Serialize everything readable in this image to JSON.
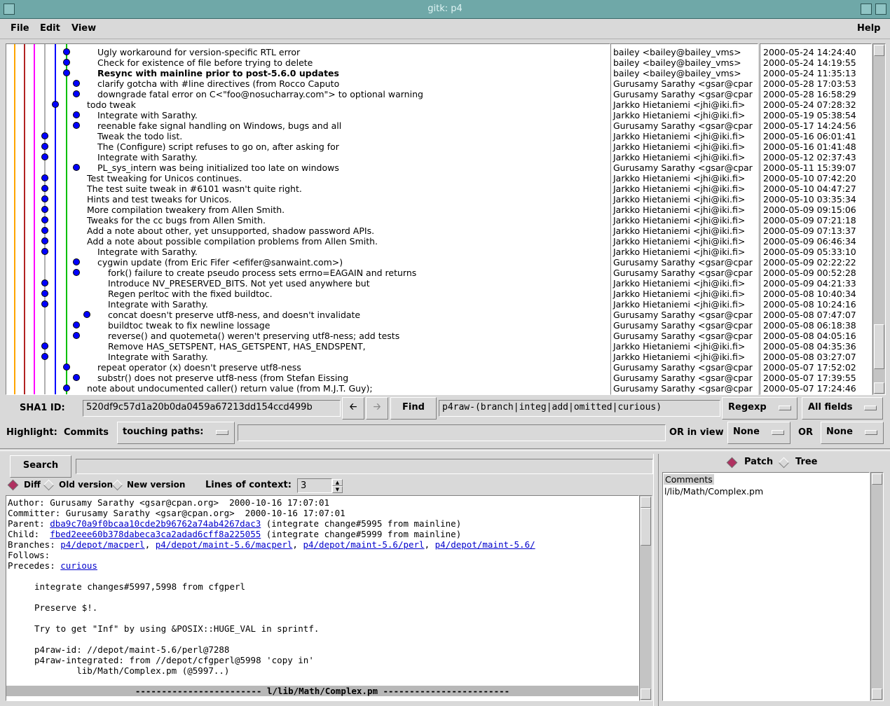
{
  "window": {
    "title": "gitk: p4"
  },
  "menu": {
    "file": "File",
    "edit": "Edit",
    "view": "View",
    "help": "Help"
  },
  "commits": [
    {
      "subject": "Ugly workaround for version-specific RTL error",
      "author": "bailey <bailey@bailey_vms>",
      "date": "2000-05-24 14:24:40",
      "bold": false
    },
    {
      "subject": "Check for existence of file before trying to delete",
      "author": "bailey <bailey@bailey_vms>",
      "date": "2000-05-24 14:19:55",
      "bold": false
    },
    {
      "subject": "Resync with mainline prior to post-5.6.0 updates",
      "author": "bailey <bailey@bailey_vms>",
      "date": "2000-05-24 11:35:13",
      "bold": true
    },
    {
      "subject": "clarify gotcha with #line directives (from Rocco Caputo",
      "author": "Gurusamy Sarathy <gsar@cpar",
      "date": "2000-05-28 17:03:53",
      "bold": false
    },
    {
      "subject": "downgrade fatal error on C<\"foo@nosucharray.com\"> to optional warning",
      "author": "Gurusamy Sarathy <gsar@cpar",
      "date": "2000-05-28 16:58:29",
      "bold": false
    },
    {
      "subject": "todo tweak",
      "author": "Jarkko Hietaniemi <jhi@iki.fi>",
      "date": "2000-05-24 07:28:32",
      "bold": false
    },
    {
      "subject": "Integrate with Sarathy.",
      "author": "Jarkko Hietaniemi <jhi@iki.fi>",
      "date": "2000-05-19 05:38:54",
      "bold": false
    },
    {
      "subject": "reenable fake signal handling on Windows, bugs and all",
      "author": "Gurusamy Sarathy <gsar@cpar",
      "date": "2000-05-17 14:24:56",
      "bold": false
    },
    {
      "subject": "Tweak the todo list.",
      "author": "Jarkko Hietaniemi <jhi@iki.fi>",
      "date": "2000-05-16 06:01:41",
      "bold": false
    },
    {
      "subject": "The (Configure) script refuses to go on, after asking for",
      "author": "Jarkko Hietaniemi <jhi@iki.fi>",
      "date": "2000-05-16 01:41:48",
      "bold": false
    },
    {
      "subject": "Integrate with Sarathy.",
      "author": "Jarkko Hietaniemi <jhi@iki.fi>",
      "date": "2000-05-12 02:37:43",
      "bold": false
    },
    {
      "subject": "PL_sys_intern was being initialized too late on windows",
      "author": "Gurusamy Sarathy <gsar@cpar",
      "date": "2000-05-11 15:39:07",
      "bold": false
    },
    {
      "subject": "Test tweaking for Unicos continues.",
      "author": "Jarkko Hietaniemi <jhi@iki.fi>",
      "date": "2000-05-10 07:42:20",
      "bold": false
    },
    {
      "subject": "The test suite tweak in #6101 wasn't quite right.",
      "author": "Jarkko Hietaniemi <jhi@iki.fi>",
      "date": "2000-05-10 04:47:27",
      "bold": false
    },
    {
      "subject": "Hints and test tweaks for Unicos.",
      "author": "Jarkko Hietaniemi <jhi@iki.fi>",
      "date": "2000-05-10 03:35:34",
      "bold": false
    },
    {
      "subject": "More compilation tweakery from Allen Smith.",
      "author": "Jarkko Hietaniemi <jhi@iki.fi>",
      "date": "2000-05-09 09:15:06",
      "bold": false
    },
    {
      "subject": "Tweaks for the cc bugs from Allen Smith.",
      "author": "Jarkko Hietaniemi <jhi@iki.fi>",
      "date": "2000-05-09 07:21:18",
      "bold": false
    },
    {
      "subject": "Add a note about other, yet unsupported, shadow password APIs.",
      "author": "Jarkko Hietaniemi <jhi@iki.fi>",
      "date": "2000-05-09 07:13:37",
      "bold": false
    },
    {
      "subject": "Add a note about possible compilation problems from Allen Smith.",
      "author": "Jarkko Hietaniemi <jhi@iki.fi>",
      "date": "2000-05-09 06:46:34",
      "bold": false
    },
    {
      "subject": "Integrate with Sarathy.",
      "author": "Jarkko Hietaniemi <jhi@iki.fi>",
      "date": "2000-05-09 05:33:10",
      "bold": false
    },
    {
      "subject": "cygwin update (from Eric Fifer <efifer@sanwaint.com>)",
      "author": "Gurusamy Sarathy <gsar@cpar",
      "date": "2000-05-09 02:22:22",
      "bold": false
    },
    {
      "subject": "fork() failure to create pseudo process sets errno=EAGAIN and returns",
      "author": "Gurusamy Sarathy <gsar@cpar",
      "date": "2000-05-09 00:52:28",
      "bold": false
    },
    {
      "subject": "Introduce NV_PRESERVED_BITS.  Not yet used anywhere but",
      "author": "Jarkko Hietaniemi <jhi@iki.fi>",
      "date": "2000-05-09 04:21:33",
      "bold": false
    },
    {
      "subject": "Regen perltoc with the fixed buildtoc.",
      "author": "Jarkko Hietaniemi <jhi@iki.fi>",
      "date": "2000-05-08 10:40:34",
      "bold": false
    },
    {
      "subject": "Integrate with Sarathy.",
      "author": "Jarkko Hietaniemi <jhi@iki.fi>",
      "date": "2000-05-08 10:24:16",
      "bold": false
    },
    {
      "subject": "concat doesn't preserve utf8-ness, and doesn't invalidate",
      "author": "Gurusamy Sarathy <gsar@cpar",
      "date": "2000-05-08 07:47:07",
      "bold": false
    },
    {
      "subject": "buildtoc tweak to fix newline lossage",
      "author": "Gurusamy Sarathy <gsar@cpar",
      "date": "2000-05-08 06:18:38",
      "bold": false
    },
    {
      "subject": "reverse() and quotemeta() weren't preserving utf8-ness; add tests",
      "author": "Gurusamy Sarathy <gsar@cpar",
      "date": "2000-05-08 04:05:16",
      "bold": false
    },
    {
      "subject": "Remove HAS_SETSPENT, HAS_GETSPENT, HAS_ENDSPENT,",
      "author": "Jarkko Hietaniemi <jhi@iki.fi>",
      "date": "2000-05-08 04:35:36",
      "bold": false
    },
    {
      "subject": "Integrate with Sarathy.",
      "author": "Jarkko Hietaniemi <jhi@iki.fi>",
      "date": "2000-05-08 03:27:07",
      "bold": false
    },
    {
      "subject": "repeat operator (x) doesn't preserve utf8-ness",
      "author": "Gurusamy Sarathy <gsar@cpar",
      "date": "2000-05-07 17:52:02",
      "bold": false
    },
    {
      "subject": "substr() does not preserve utf8-ness (from Stefan Eissing",
      "author": "Gurusamy Sarathy <gsar@cpar",
      "date": "2000-05-07 17:39:55",
      "bold": false
    },
    {
      "subject": "note about undocumented caller() return value (from M.J.T. Guy);",
      "author": "Gurusamy Sarathy <gsar@cpar",
      "date": "2000-05-07 17:24:46",
      "bold": false
    }
  ],
  "toolbar": {
    "sha1_label": "SHA1 ID:",
    "sha1_value": "520df9c57d1a20b0da0459a67213dd154ccd499b",
    "back_icon": "left-arrow-icon",
    "forward_icon": "right-arrow-icon",
    "find_label": "Find",
    "find_value": "p4raw-(branch|integ|add|omitted|curious)",
    "find_type": "Regexp",
    "find_in": "All fields"
  },
  "highlight": {
    "label": "Highlight:",
    "commits_label": "Commits",
    "mode": "touching paths:",
    "paths_value": "",
    "or_in_view_label": "OR in view",
    "view_value": "None",
    "or_label": "OR",
    "or_value": "None"
  },
  "search": {
    "button": "Search",
    "value": "",
    "diff_label": "Diff",
    "old_label": "Old version",
    "new_label": "New version",
    "context_label": "Lines of context:",
    "context_value": "3"
  },
  "details": {
    "author_label": "Author:",
    "author": "Gurusamy Sarathy <gsar@cpan.org>  2000-10-16 17:07:01",
    "committer_label": "Committer:",
    "committer": "Gurusamy Sarathy <gsar@cpan.org>  2000-10-16 17:07:01",
    "parent_label": "Parent:",
    "parent_sha": "dba9c70a9f0bcaa10cde2b96762a74ab4267dac3",
    "parent_note": "(integrate change#5995 from mainline)",
    "child_label": "Child:",
    "child_sha": "fbed2eee60b378dabeca3ca2adad6cff8a225055",
    "child_note": "(integrate change#5999 from mainline)",
    "branches_label": "Branches:",
    "branches": [
      "p4/depot/macperl",
      "p4/depot/maint-5.6/macperl",
      "p4/depot/maint-5.6/perl",
      "p4/depot/maint-5.6/"
    ],
    "follows_label": "Follows:",
    "precedes_label": "Precedes:",
    "precedes": "curious",
    "message": [
      "integrate changes#5997,5998 from cfgperl",
      "",
      "Preserve $!.",
      "",
      "Try to get \"Inf\" by using &POSIX::HUGE_VAL in sprintf.",
      "",
      "p4raw-id: //depot/maint-5.6/perl@7288",
      "p4raw-integrated: from //depot/cfgperl@5998 'copy in'",
      "        lib/Math/Complex.pm (@5997..)"
    ],
    "file_header": "------------------------ l/lib/Math/Complex.pm ------------------------"
  },
  "filelist": {
    "patch_label": "Patch",
    "tree_label": "Tree",
    "items": [
      "Comments",
      "l/lib/Math/Complex.pm"
    ]
  },
  "colors": {
    "title_bar": "#6fa8a8",
    "node": "#0000ff",
    "link": "#0000cc"
  }
}
